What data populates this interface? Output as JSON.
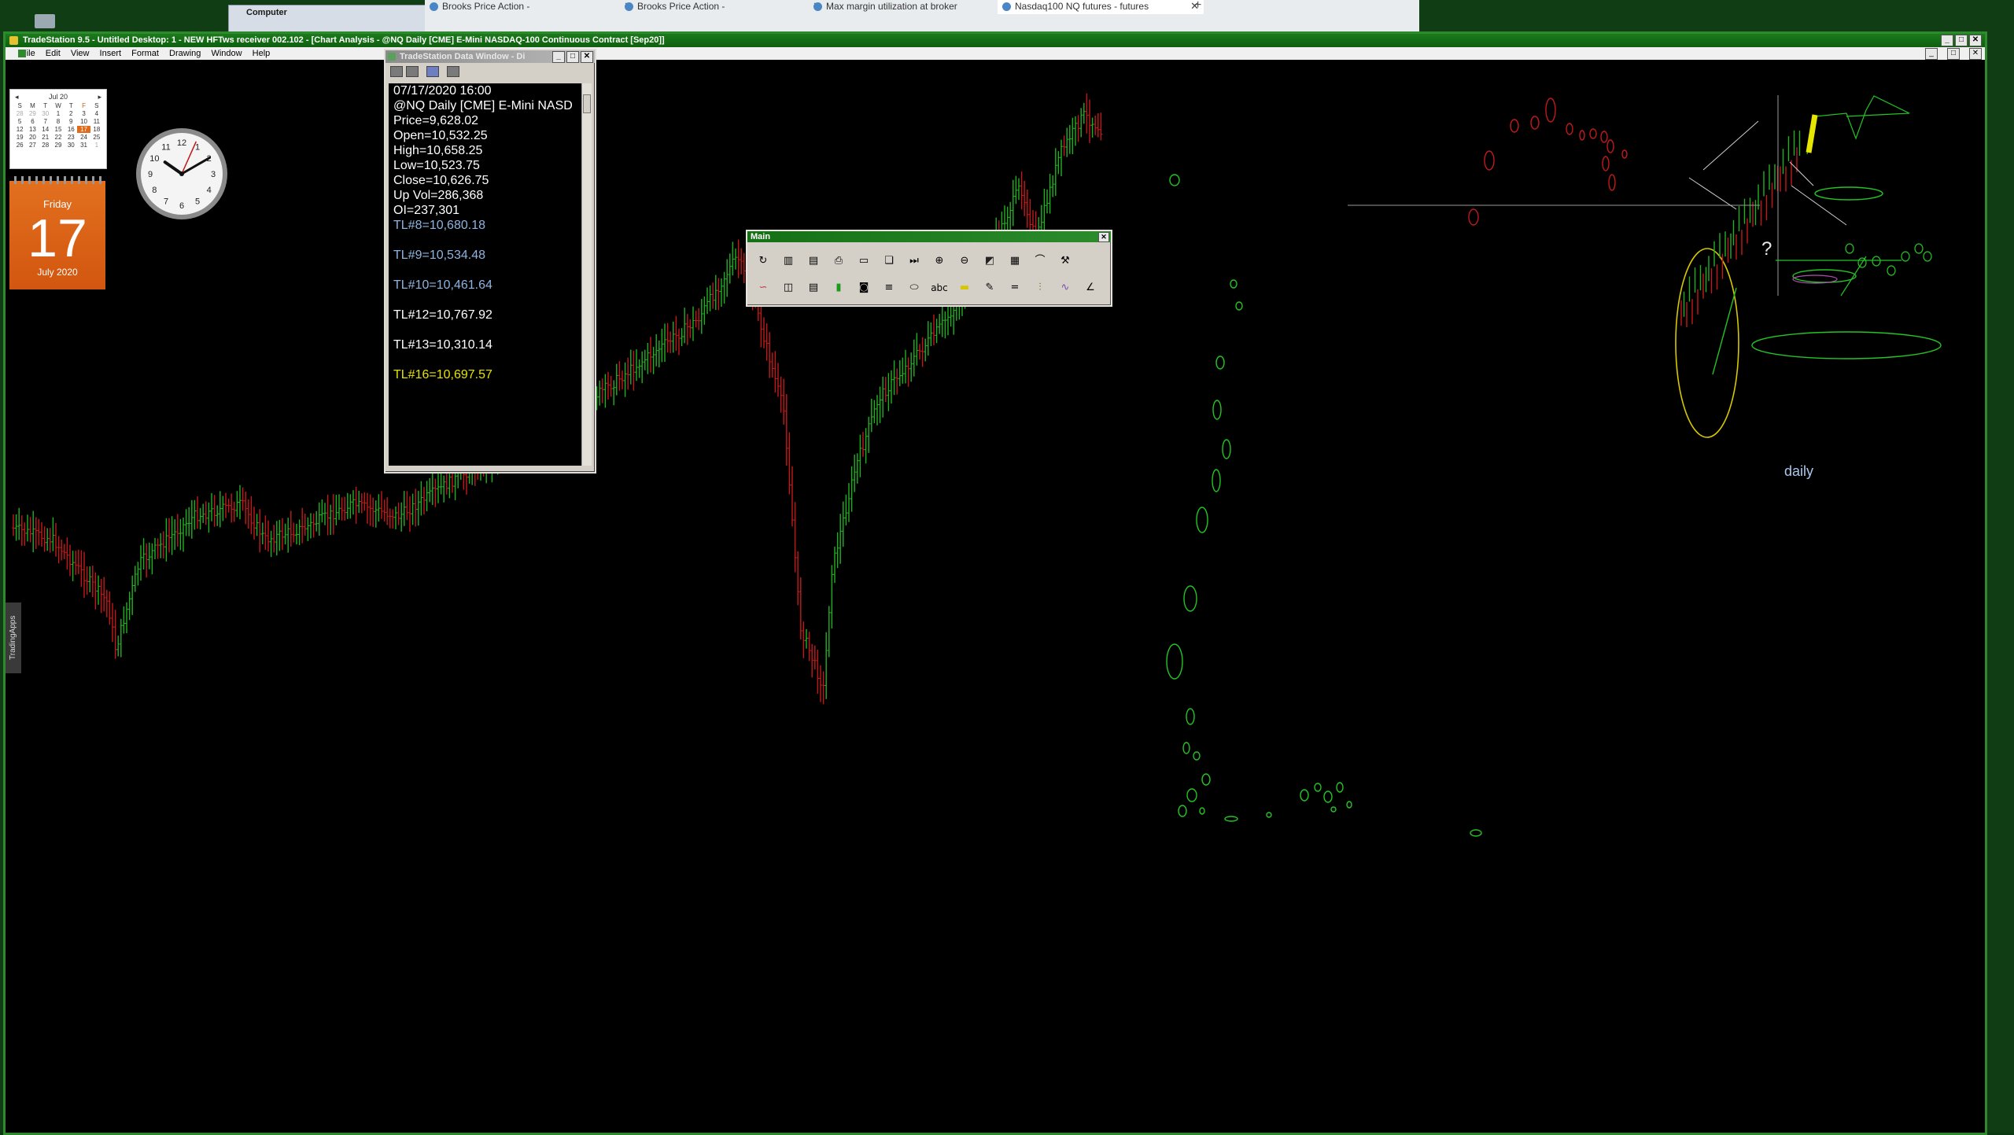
{
  "browser": {
    "tabs": [
      {
        "label": "Brooks Price Action -",
        "active": false
      },
      {
        "label": "Brooks Price Action -",
        "active": false
      },
      {
        "label": "Max margin utilization at broker",
        "active": false
      },
      {
        "label": "Nasdaq100 NQ futures - futures",
        "active": true
      }
    ],
    "new_tab_label": "+"
  },
  "computer_window": {
    "title": "Computer"
  },
  "tradestation": {
    "title": "TradeStation 9.5 - Untitled Desktop: 1 - NEW HFTws receiver 002.102 - [Chart Analysis - @NQ Daily [CME] E-Mini NASDAQ-100 Continuous Contract [Sep20]]",
    "menu": [
      "File",
      "Edit",
      "View",
      "Insert",
      "Format",
      "Drawing",
      "Window",
      "Help"
    ],
    "tradingapps_label": "TradingApps"
  },
  "calendar": {
    "month_label": "Jul 20",
    "weekdays": [
      "S",
      "M",
      "T",
      "W",
      "T",
      "F",
      "S"
    ],
    "weeks": [
      [
        "28",
        "29",
        "30",
        "1",
        "2",
        "3",
        "4"
      ],
      [
        "5",
        "6",
        "7",
        "8",
        "9",
        "10",
        "11"
      ],
      [
        "12",
        "13",
        "14",
        "15",
        "16",
        "17",
        "18"
      ],
      [
        "19",
        "20",
        "21",
        "22",
        "23",
        "24",
        "25"
      ],
      [
        "26",
        "27",
        "28",
        "29",
        "30",
        "31",
        "1"
      ]
    ],
    "today": "17"
  },
  "date_tile": {
    "weekday": "Friday",
    "day": "17",
    "month_year": "July 2020"
  },
  "clock": {
    "hour": 10,
    "minute": 10,
    "second": 4
  },
  "data_window": {
    "title": "TradeStation Data Window - Di",
    "lines": [
      {
        "text": "07/17/2020 16:00",
        "color": "white"
      },
      {
        "text": "@NQ Daily [CME] E-Mini NASD",
        "color": "white"
      },
      {
        "text": "Price=9,628.02",
        "color": "white"
      },
      {
        "text": "Open=10,532.25",
        "color": "white"
      },
      {
        "text": "High=10,658.25",
        "color": "white"
      },
      {
        "text": "Low=10,523.75",
        "color": "white"
      },
      {
        "text": "Close=10,626.75",
        "color": "white"
      },
      {
        "text": "Up Vol=286,368",
        "color": "white"
      },
      {
        "text": "OI=237,301",
        "color": "white"
      },
      {
        "text": "TL#8=10,680.18",
        "color": "blue"
      },
      {
        "text": "",
        "color": "white"
      },
      {
        "text": "TL#9=10,534.48",
        "color": "blue"
      },
      {
        "text": "",
        "color": "white"
      },
      {
        "text": "TL#10=10,461.64",
        "color": "blue"
      },
      {
        "text": "",
        "color": "white"
      },
      {
        "text": "TL#12=10,767.92",
        "color": "white"
      },
      {
        "text": "",
        "color": "white"
      },
      {
        "text": "TL#13=10,310.14",
        "color": "white"
      },
      {
        "text": "",
        "color": "white"
      },
      {
        "text": "TL#16=10,697.57",
        "color": "yellow"
      }
    ]
  },
  "main_toolbar": {
    "title": "Main",
    "row1_icons": [
      "chart-refresh-icon",
      "grid-icon",
      "open-folder-icon",
      "print-icon",
      "page-setup-icon",
      "copy-page-icon",
      "jump-last-bar-icon",
      "zoom-in-icon",
      "zoom-out-icon",
      "color-scheme-icon",
      "table-icon",
      "curve-icon",
      "tools-icon"
    ],
    "row2_icons": [
      "indicator-icon",
      "strategy-icon",
      "data-icon",
      "trend-icon",
      "news-icon",
      "lines-icon",
      "ellipse-icon",
      "text-label-icon",
      "highlight-icon",
      "pen-icon",
      "equal-line-icon",
      "fib-icon",
      "wave-icon",
      "angle-icon"
    ],
    "text_tool_label": "abc"
  },
  "chart": {
    "annotation_label": "daily",
    "question_label": "?",
    "bull_color": "#21b021",
    "bear_color": "#c21a1a",
    "ellipse_color": "#24c424",
    "highlight_color": "#e6e600"
  }
}
